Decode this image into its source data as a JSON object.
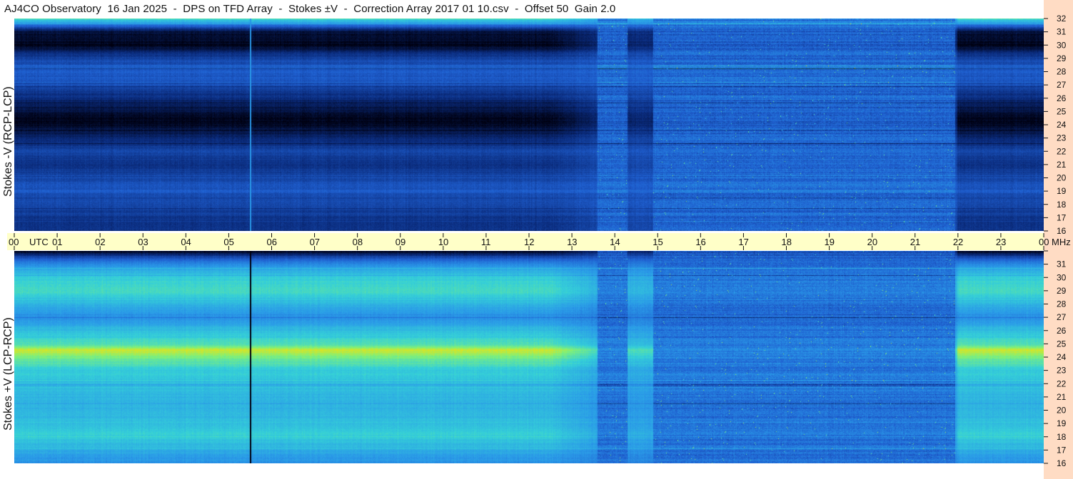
{
  "title": "AJ4CO Observatory  16 Jan 2025  -  DPS on TFD Array  -  Stokes ±V  -  Correction Array 2017 01 10.csv  -  Offset 50  Gain 2.0",
  "chart_data": [
    {
      "type": "heatmap",
      "ylabel": "Stokes -V (RCP-LCP)",
      "x_unit": "UTC",
      "y_unit": "MHz",
      "xlim": [
        0,
        24
      ],
      "ylim": [
        16,
        32
      ],
      "colormap": [
        "#000010",
        "#0a2a7a",
        "#1f5fd0",
        "#2a9ae8",
        "#35d0d8",
        "#7ff07a",
        "#ffe000",
        "#ff4010"
      ],
      "level_by_frequency_MHz": [
        {
          "mhz": 32,
          "level": 0.62
        },
        {
          "mhz": 31.5,
          "level": 0.3
        },
        {
          "mhz": 31,
          "level": 0.05
        },
        {
          "mhz": 30,
          "level": 0.02
        },
        {
          "mhz": 29.5,
          "level": 0.12
        },
        {
          "mhz": 29,
          "level": 0.22
        },
        {
          "mhz": 28,
          "level": 0.28
        },
        {
          "mhz": 27,
          "level": 0.24
        },
        {
          "mhz": 26,
          "level": 0.14
        },
        {
          "mhz": 25,
          "level": 0.06
        },
        {
          "mhz": 24.5,
          "level": 0.01
        },
        {
          "mhz": 24,
          "level": 0.03
        },
        {
          "mhz": 23,
          "level": 0.12
        },
        {
          "mhz": 22,
          "level": 0.22
        },
        {
          "mhz": 21,
          "level": 0.16
        },
        {
          "mhz": 20,
          "level": 0.22
        },
        {
          "mhz": 19,
          "level": 0.26
        },
        {
          "mhz": 18,
          "level": 0.22
        },
        {
          "mhz": 17,
          "level": 0.18
        },
        {
          "mhz": 16,
          "level": 0.16
        }
      ],
      "secondary_level": 0.33,
      "secondary_windows_UTC": [
        [
          13.6,
          14.3
        ],
        [
          14.9,
          21.95
        ]
      ],
      "vertical_line_UTC": 5.5
    },
    {
      "type": "heatmap",
      "ylabel": "Stokes +V (LCP-RCP)",
      "x_unit": "UTC",
      "y_unit": "MHz",
      "xlim": [
        0,
        24
      ],
      "ylim": [
        16,
        32
      ],
      "colormap": [
        "#000010",
        "#0a2a7a",
        "#1f5fd0",
        "#2a9ae8",
        "#35d0d8",
        "#7ff07a",
        "#ffe000",
        "#ff4010"
      ],
      "level_by_frequency_MHz": [
        {
          "mhz": 32,
          "level": 0.02
        },
        {
          "mhz": 31.5,
          "level": 0.25
        },
        {
          "mhz": 31,
          "level": 0.4
        },
        {
          "mhz": 30,
          "level": 0.56
        },
        {
          "mhz": 29,
          "level": 0.6
        },
        {
          "mhz": 28,
          "level": 0.5
        },
        {
          "mhz": 27,
          "level": 0.4
        },
        {
          "mhz": 26,
          "level": 0.52
        },
        {
          "mhz": 25,
          "level": 0.62
        },
        {
          "mhz": 24.5,
          "level": 0.8
        },
        {
          "mhz": 24,
          "level": 0.7
        },
        {
          "mhz": 23,
          "level": 0.56
        },
        {
          "mhz": 22,
          "level": 0.52
        },
        {
          "mhz": 21,
          "level": 0.5
        },
        {
          "mhz": 20,
          "level": 0.5
        },
        {
          "mhz": 19,
          "level": 0.52
        },
        {
          "mhz": 18,
          "level": 0.57
        },
        {
          "mhz": 17,
          "level": 0.48
        },
        {
          "mhz": 16,
          "level": 0.4
        }
      ],
      "secondary_level": 0.3,
      "secondary_windows_UTC": [
        [
          13.6,
          14.3
        ],
        [
          14.9,
          21.95
        ]
      ],
      "vertical_line_UTC": 5.5
    }
  ],
  "x_ticks": [
    "00",
    "01",
    "02",
    "03",
    "04",
    "05",
    "06",
    "07",
    "08",
    "09",
    "10",
    "11",
    "12",
    "13",
    "14",
    "15",
    "16",
    "17",
    "18",
    "19",
    "20",
    "21",
    "22",
    "23",
    "00"
  ],
  "x_utc_label": "UTC",
  "x_unit_label": "MHz",
  "y_ticks": [
    "32",
    "31",
    "30",
    "29",
    "28",
    "27",
    "26",
    "25",
    "24",
    "23",
    "22",
    "21",
    "20",
    "19",
    "18",
    "17",
    "16"
  ],
  "colors": {
    "time_strip": "#ffffc8",
    "freq_strip": "#ffdcc4"
  }
}
